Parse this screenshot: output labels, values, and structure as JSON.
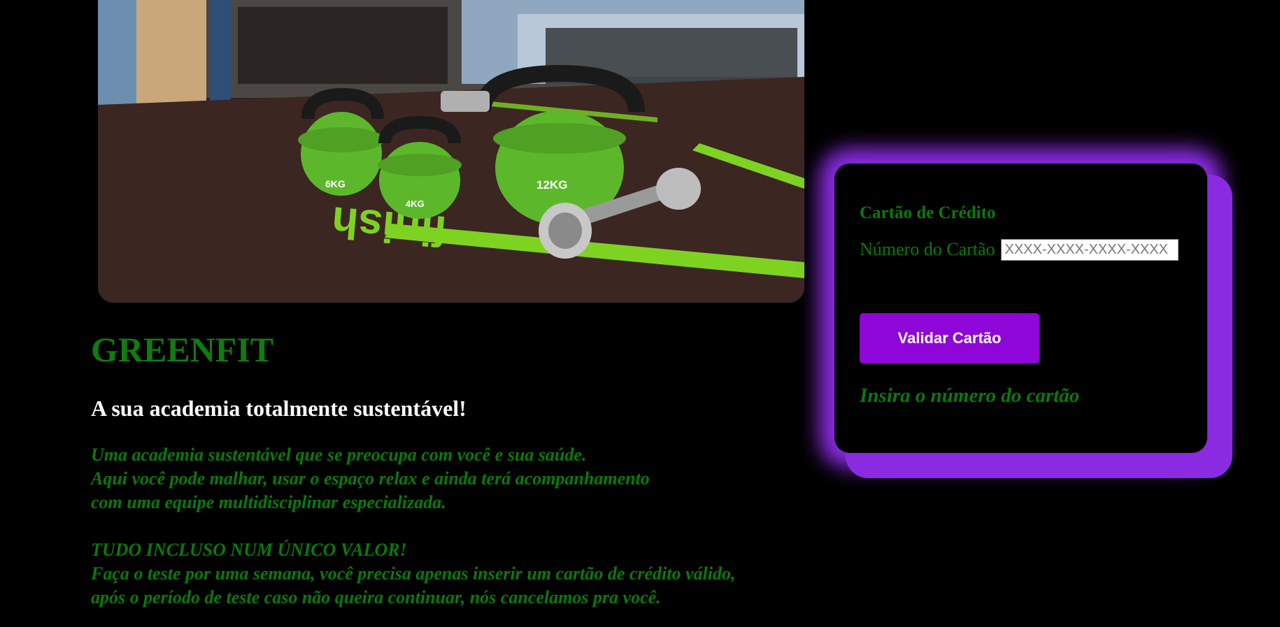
{
  "hero": {
    "kettlebell_labels": [
      "6KG",
      "4KG",
      "12KG"
    ],
    "floor_text": "finish",
    "accent_color": "#7ed321"
  },
  "brand": {
    "name": "GREENFIT",
    "color": "#107c10"
  },
  "tagline": "A sua academia totalmente sustentável!",
  "description": {
    "lines": [
      "Uma academia sustentável que se preocupa com você e sua saúde.",
      "Aqui você pode malhar, usar o espaço relax e ainda terá acompanhamento",
      "com uma equipe multidisciplinar especializada."
    ]
  },
  "offer": {
    "lines": [
      "TUDO INCLUSO NUM ÚNICO VALOR!",
      "Faça o teste por uma semana, você precisa apenas inserir um cartão de crédito válido,",
      "após o período de teste caso não queira continuar, nós cancelamos pra você."
    ]
  },
  "card_form": {
    "title": "Cartão de Crédito",
    "field_label": "Número do Cartão",
    "input_value": "",
    "input_placeholder": "XXXX-XXXX-XXXX-XXXX",
    "button_label": "Validar Cartão",
    "status_message": "Insira o número do cartão",
    "accent_color": "#8a2be2",
    "button_color": "#8f06d8"
  }
}
